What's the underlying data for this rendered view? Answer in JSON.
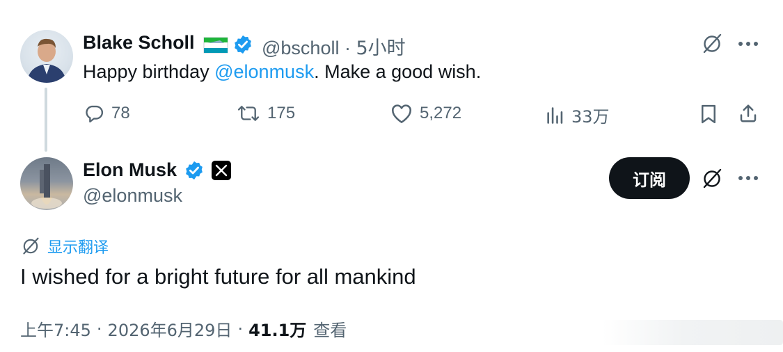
{
  "reply_tweet": {
    "author_name": "Blake Scholl",
    "handle": "@bscholl",
    "separator": "·",
    "time": "5小时",
    "text_prefix": "Happy birthday ",
    "mention": "@elonmusk",
    "text_suffix": ". Make a good wish.",
    "stats": {
      "replies": "78",
      "reposts": "175",
      "likes": "5,272",
      "views": "33万"
    }
  },
  "main_tweet": {
    "author_name": "Elon Musk",
    "handle": "@elonmusk",
    "subscribe_label": "订阅",
    "translate_label": "显示翻译",
    "text": "I wished for a bright future for all mankind",
    "time": "上午7:45",
    "date": "2026年6月29日",
    "views_count": "41.1万",
    "views_label": "查看",
    "separator": "·"
  },
  "colors": {
    "accent": "#1d9bf0",
    "text_primary": "#0f1419",
    "text_secondary": "#536471",
    "button_dark": "#0f1419",
    "thread_line": "#cfd9de"
  },
  "icons": {
    "verified": "verified-badge-icon",
    "grok": "grok-icon",
    "more": "more-icon",
    "reply": "reply-icon",
    "repost": "repost-icon",
    "like": "heart-icon",
    "views": "views-chart-icon",
    "bookmark": "bookmark-icon",
    "share": "share-icon",
    "x_logo": "x-logo-icon",
    "flag": "flag-icon"
  }
}
